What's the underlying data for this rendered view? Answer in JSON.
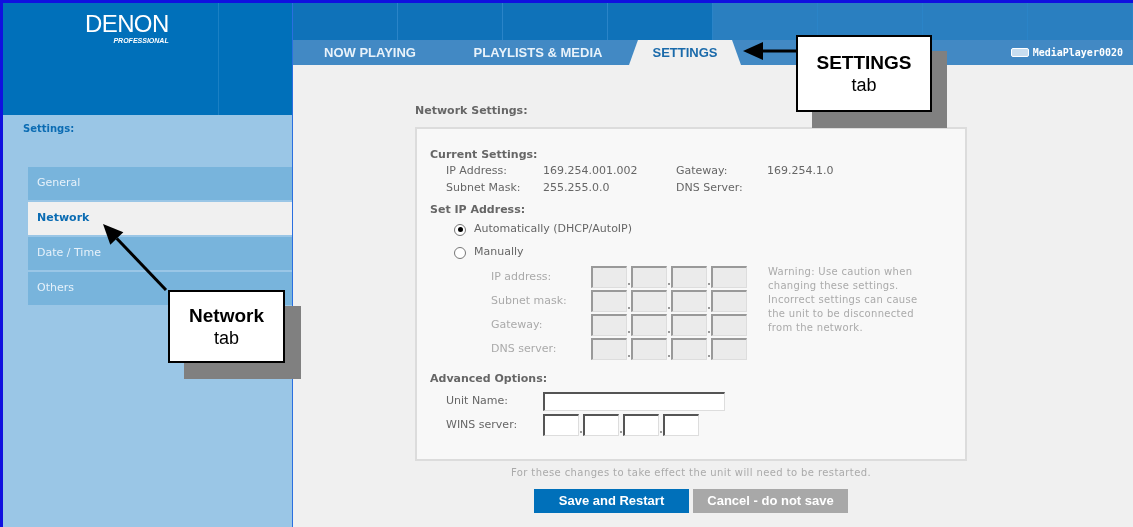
{
  "logo": {
    "name": "DENON",
    "tagline": "PROFESSIONAL"
  },
  "tabs": [
    {
      "label": "NOW PLAYING",
      "selected": false
    },
    {
      "label": "PLAYLISTS & MEDIA",
      "selected": false
    },
    {
      "label": "SETTINGS",
      "selected": true
    }
  ],
  "device": {
    "name": "MediaPlayer0020"
  },
  "sidebar": {
    "heading": "Settings:",
    "items": [
      {
        "label": "General",
        "selected": false
      },
      {
        "label": "Network",
        "selected": true
      },
      {
        "label": "Date / Time",
        "selected": false
      },
      {
        "label": "Others",
        "selected": false
      }
    ]
  },
  "section_title": "Network Settings:",
  "current_settings": {
    "heading": "Current Settings:",
    "fields": [
      {
        "label": "IP Address:",
        "value": "169.254.001.002"
      },
      {
        "label": "Gateway:",
        "value": "169.254.1.0"
      },
      {
        "label": "Subnet Mask:",
        "value": "255.255.0.0"
      },
      {
        "label": "DNS Server:"
      }
    ]
  },
  "set_ip": {
    "heading": "Set IP Address:",
    "options": [
      {
        "label": "Automatically (DHCP/AutoIP)",
        "selected": true
      },
      {
        "label": "Manually",
        "selected": false
      }
    ],
    "manual": {
      "disabled": true,
      "fields": [
        {
          "label": "IP address:"
        },
        {
          "label": "Subnet mask:"
        },
        {
          "label": "Gateway:"
        },
        {
          "label": "DNS server:"
        }
      ],
      "warning": "Warning: Use caution when changing these settings. Incorrect settings can cause the unit to be disconnected from the network."
    }
  },
  "advanced": {
    "heading": "Advanced Options:",
    "unit_name": {
      "label": "Unit Name:"
    },
    "wins_server": {
      "label": "WINS server:"
    }
  },
  "note": "For these changes to take effect the unit will need to be restarted.",
  "buttons": [
    {
      "label": "Save and Restart",
      "kind": "primary"
    },
    {
      "label": "Cancel - do not save",
      "kind": "secondary"
    }
  ],
  "callouts": [
    {
      "title": "SETTINGS",
      "caption": "tab"
    },
    {
      "title": "Network",
      "caption": "tab"
    }
  ]
}
